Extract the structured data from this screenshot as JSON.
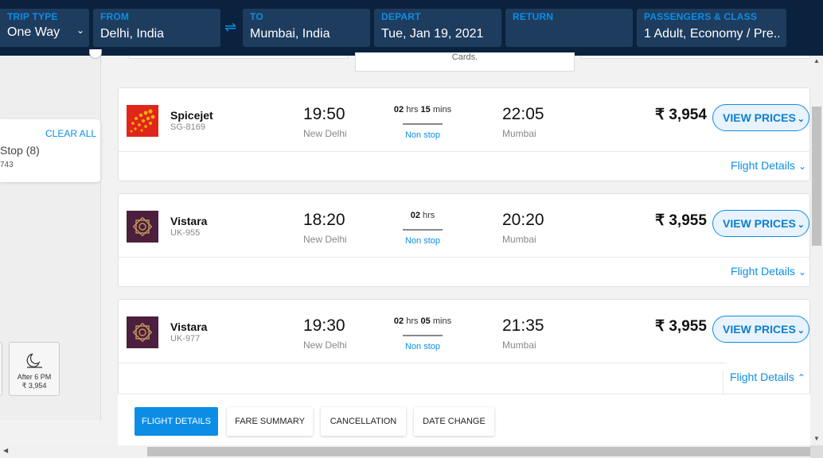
{
  "search": {
    "trip_type": {
      "label": "TRIP TYPE",
      "value": "One Way"
    },
    "from": {
      "label": "FROM",
      "value": "Delhi, India"
    },
    "to": {
      "label": "TO",
      "value": "Mumbai, India"
    },
    "depart": {
      "label": "DEPART",
      "value": "Tue, Jan 19, 2021"
    },
    "return": {
      "label": "RETURN",
      "value": ""
    },
    "passengers": {
      "label": "PASSENGERS & CLASS",
      "value": "1 Adult, Economy / Pre..."
    }
  },
  "banner": {
    "cards_text": "Cards."
  },
  "filters": {
    "clear_all": "CLEAR ALL",
    "stop_label": "Stop (8)",
    "stop_price": "743",
    "time_option": {
      "line1": "After 6 PM",
      "line2": "₹ 3,954"
    }
  },
  "flights": [
    {
      "airline": "Spicejet",
      "code": "SG-8169",
      "dep_time": "19:50",
      "dep_city": "New Delhi",
      "arr_time": "22:05",
      "arr_city": "Mumbai",
      "dur_hrs": "02",
      "dur_hrs_unit": "hrs",
      "dur_mins": "15",
      "dur_mins_unit": "mins",
      "stops": "Non stop",
      "price": "₹ 3,954",
      "view_prices": "VIEW PRICES",
      "details_link": "Flight Details",
      "logo_icon": "spicejet-logo",
      "expanded": false
    },
    {
      "airline": "Vistara",
      "code": "UK-955",
      "dep_time": "18:20",
      "dep_city": "New Delhi",
      "arr_time": "20:20",
      "arr_city": "Mumbai",
      "dur_hrs": "02",
      "dur_hrs_unit": "hrs",
      "dur_mins": "",
      "dur_mins_unit": "",
      "stops": "Non stop",
      "price": "₹ 3,955",
      "view_prices": "VIEW PRICES",
      "details_link": "Flight Details",
      "logo_icon": "vistara-logo",
      "expanded": false
    },
    {
      "airline": "Vistara",
      "code": "UK-977",
      "dep_time": "19:30",
      "dep_city": "New Delhi",
      "arr_time": "21:35",
      "arr_city": "Mumbai",
      "dur_hrs": "02",
      "dur_hrs_unit": "hrs",
      "dur_mins": "05",
      "dur_mins_unit": "mins",
      "stops": "Non stop",
      "price": "₹ 3,955",
      "view_prices": "VIEW PRICES",
      "details_link": "Flight Details",
      "logo_icon": "vistara-logo",
      "expanded": true
    }
  ],
  "detail_tabs": [
    "FLIGHT DETAILS",
    "FARE SUMMARY",
    "CANCELLATION",
    "DATE CHANGE"
  ],
  "active_tab": "FLIGHT DETAILS",
  "colors": {
    "header_bg": "#0a223d",
    "field_bg": "#1e3c5e",
    "accent": "#0c8ee6",
    "spicejet_red": "#e0261b",
    "spicejet_yellow": "#f5b400",
    "vistara_purple": "#4b1f3d",
    "vistara_gold": "#c49a5a"
  }
}
